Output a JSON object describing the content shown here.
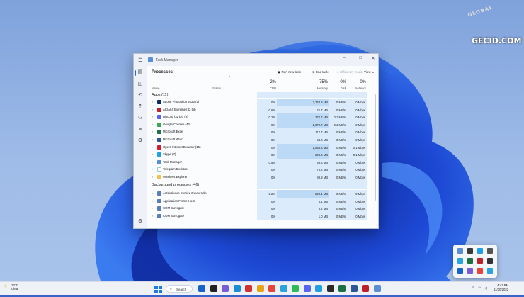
{
  "watermark": {
    "top_text": "GLOBAL",
    "brand": "GECID.COM"
  },
  "window": {
    "title": "Task Manager",
    "controls": {
      "minimize": "–",
      "maximize": "□",
      "close": "✕"
    }
  },
  "toolbar": {
    "page_title": "Processes",
    "run_new_task": "Run new task",
    "end_task": "End task",
    "efficiency_mode": "Efficiency mode",
    "view": "View"
  },
  "columns": {
    "name": "Name",
    "status": "Status",
    "cpu": {
      "label": "CPU",
      "pct": "2%"
    },
    "memory": {
      "label": "Memory",
      "pct": "75%"
    },
    "disk": {
      "label": "Disk",
      "pct": "0%"
    },
    "network": {
      "label": "Network",
      "pct": "0%"
    }
  },
  "groups": {
    "apps": "Apps (11)",
    "background": "Background processes (46)"
  },
  "apps": [
    {
      "name": "Adobe Photoshop 2023 (2)",
      "cpu": "0%",
      "memory": "2,764.8 MB",
      "disk": "0 MB/s",
      "network": "0 Mbps",
      "icon": "photoshop-icon",
      "color": "#0b2b5a"
    },
    {
      "name": "AIDA64 Extreme (32 bit)",
      "cpu": "0.6%",
      "memory": "75.7 MB",
      "disk": "0 MB/s",
      "network": "0 Mbps",
      "icon": "aida64-icon",
      "color": "#c0202a"
    },
    {
      "name": "Discord (32 bit) (6)",
      "cpu": "0.2%",
      "memory": "272.7 MB",
      "disk": "0.1 MB/s",
      "network": "0 Mbps",
      "icon": "discord-icon",
      "color": "#5865f2"
    },
    {
      "name": "Google Chrome (43)",
      "cpu": "0%",
      "memory": "2,070.7 MB",
      "disk": "0.1 MB/s",
      "network": "0 Mbps",
      "icon": "chrome-icon",
      "color": "#3aa757"
    },
    {
      "name": "Microsoft Excel",
      "cpu": "0%",
      "memory": "117.7 MB",
      "disk": "0 MB/s",
      "network": "0 Mbps",
      "icon": "excel-icon",
      "color": "#1d7044"
    },
    {
      "name": "Microsoft Word",
      "cpu": "0%",
      "memory": "54.3 MB",
      "disk": "0 MB/s",
      "network": "0 Mbps",
      "icon": "word-icon",
      "color": "#2b5797"
    },
    {
      "name": "Opera Internet Browser (15)",
      "cpu": "0%",
      "memory": "1,556.3 MB",
      "disk": "0 MB/s",
      "network": "0.1 Mbps",
      "icon": "opera-icon",
      "color": "#d41c2b"
    },
    {
      "name": "Skype (7)",
      "cpu": "0%",
      "memory": "228.2 MB",
      "disk": "0 MB/s",
      "network": "0.1 Mbps",
      "icon": "skype-icon",
      "color": "#1fa0e3"
    },
    {
      "name": "Task Manager",
      "cpu": "0.5%",
      "memory": "59.5 MB",
      "disk": "0 MB/s",
      "network": "0 Mbps",
      "icon": "task-manager-icon",
      "color": "#5a8fd6"
    },
    {
      "name": "Telegram Desktop",
      "cpu": "0%",
      "memory": "75.2 MB",
      "disk": "0 MB/s",
      "network": "0 Mbps",
      "icon": "telegram-icon",
      "color": "#ffffff"
    },
    {
      "name": "Windows Explorer",
      "cpu": "0%",
      "memory": "89.9 MB",
      "disk": "0 MB/s",
      "network": "0 Mbps",
      "icon": "folder-icon",
      "color": "#f2c14e"
    }
  ],
  "background": [
    {
      "name": "Antimalware Service Executable",
      "cpu": "0.2%",
      "memory": "228.1 MB",
      "disk": "0 MB/s",
      "network": "0 Mbps",
      "icon": "service-icon",
      "color": "#5a7fb8"
    },
    {
      "name": "Application Frame Host",
      "cpu": "0%",
      "memory": "5.1 MB",
      "disk": "0 MB/s",
      "network": "0 Mbps",
      "icon": "service-icon",
      "color": "#5a7fb8"
    },
    {
      "name": "COM Surrogate",
      "cpu": "0%",
      "memory": "3.2 MB",
      "disk": "0 MB/s",
      "network": "0 Mbps",
      "icon": "service-icon",
      "color": "#5a7fb8"
    },
    {
      "name": "COM Surrogate",
      "cpu": "0%",
      "memory": "1.0 MB",
      "disk": "0 MB/s",
      "network": "0 Mbps",
      "icon": "service-icon",
      "color": "#5a7fb8"
    }
  ],
  "taskbar": {
    "weather_temp": "12°C",
    "weather_cond": "Clear",
    "search": "Search",
    "time": "4:41 PM",
    "date": "11/30/2022",
    "icon_colors": [
      "#1664c8",
      "#222222",
      "#7b5cd6",
      "#1a8ed4",
      "#d62f2f",
      "#e8a317",
      "#e8443a",
      "#2aa3de",
      "#2dbb56",
      "#5865f2",
      "#1fa0e3",
      "#2a2a2a",
      "#1d7044",
      "#2b5797",
      "#c0202a",
      "#5a8fd6"
    ]
  }
}
